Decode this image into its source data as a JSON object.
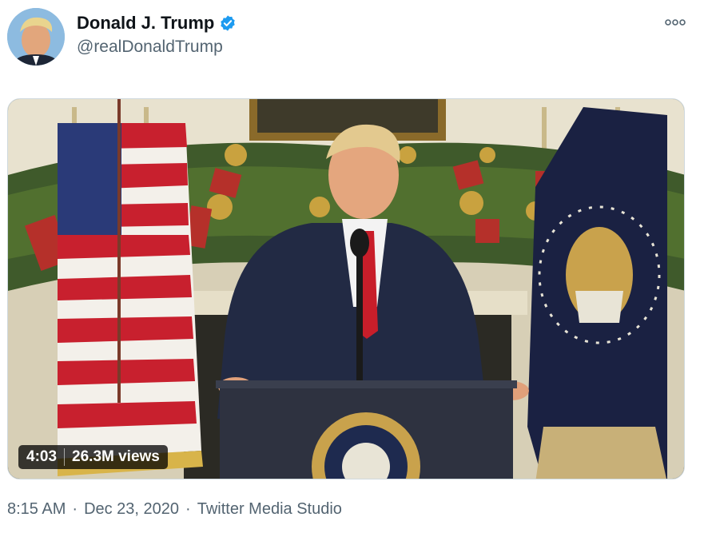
{
  "tweet": {
    "display_name": "Donald J. Trump",
    "handle": "@realDonaldTrump",
    "verified": true,
    "more_icon": "more-horizontal-icon"
  },
  "video": {
    "duration": "4:03",
    "views": "26.3M views"
  },
  "meta": {
    "time": "8:15 AM",
    "separator": "·",
    "date": "Dec 23, 2020",
    "source": "Twitter Media Studio"
  },
  "colors": {
    "verified_blue": "#1d9bf0",
    "secondary_text": "#536471",
    "primary_text": "#0f1419"
  }
}
